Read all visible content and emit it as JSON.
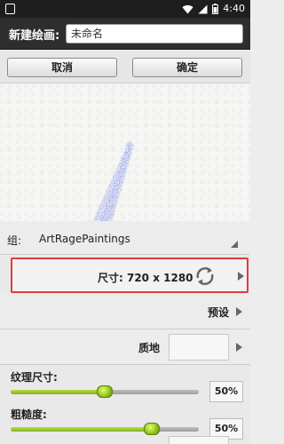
{
  "status_bar": {
    "time": "4:40",
    "icons": [
      "notification-icon",
      "wifi-icon",
      "signal-icon",
      "battery-icon"
    ]
  },
  "title_bar": {
    "label": "新建绘画:",
    "name_value": "未命名"
  },
  "action_bar": {
    "cancel_label": "取消",
    "ok_label": "确定"
  },
  "canvas": {
    "stroke_color": "#4a5fe0"
  },
  "settings": {
    "group_label": "组:",
    "group_value": "ArtRagePaintings",
    "size_label": "尺寸: 720 x 1280",
    "preset_label": "预设",
    "texture_label": "质地",
    "texture_size": {
      "label": "纹理尺寸:",
      "value_text": "50%",
      "value": 0.5
    },
    "roughness": {
      "label": "粗糙度:",
      "value_text": "50%",
      "value": 0.75
    }
  },
  "colors": {
    "highlight_border": "#e23b3b",
    "slider_fill": "#8cc21a",
    "title_bar_bg": "#2e2e2e"
  }
}
